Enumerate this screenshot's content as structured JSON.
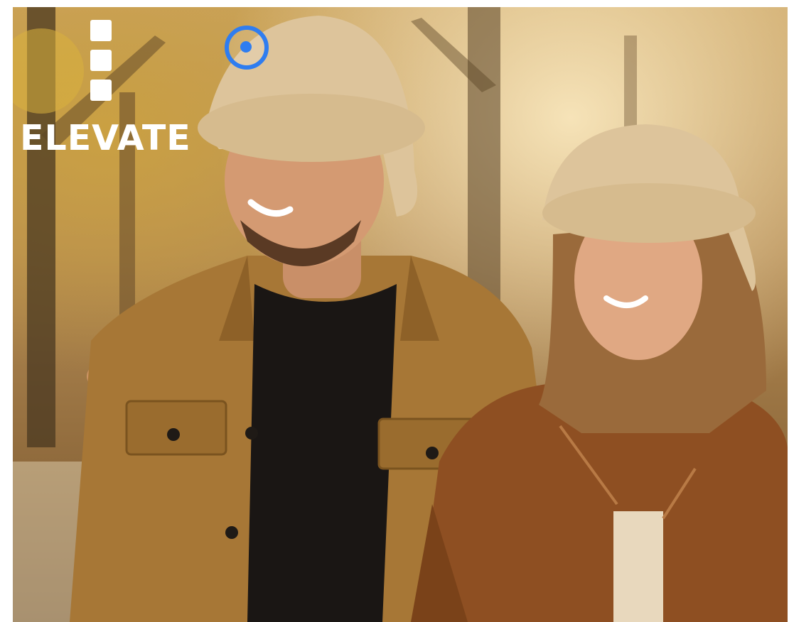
{
  "brand": {
    "logo_text": "ELEVATE"
  },
  "menu": {
    "icon": "hamburger-menu-icon"
  },
  "hero_image": {
    "subject": "photo"
  },
  "cursor": {
    "icon": "target-ring-icon",
    "color": "#2f7df0"
  }
}
